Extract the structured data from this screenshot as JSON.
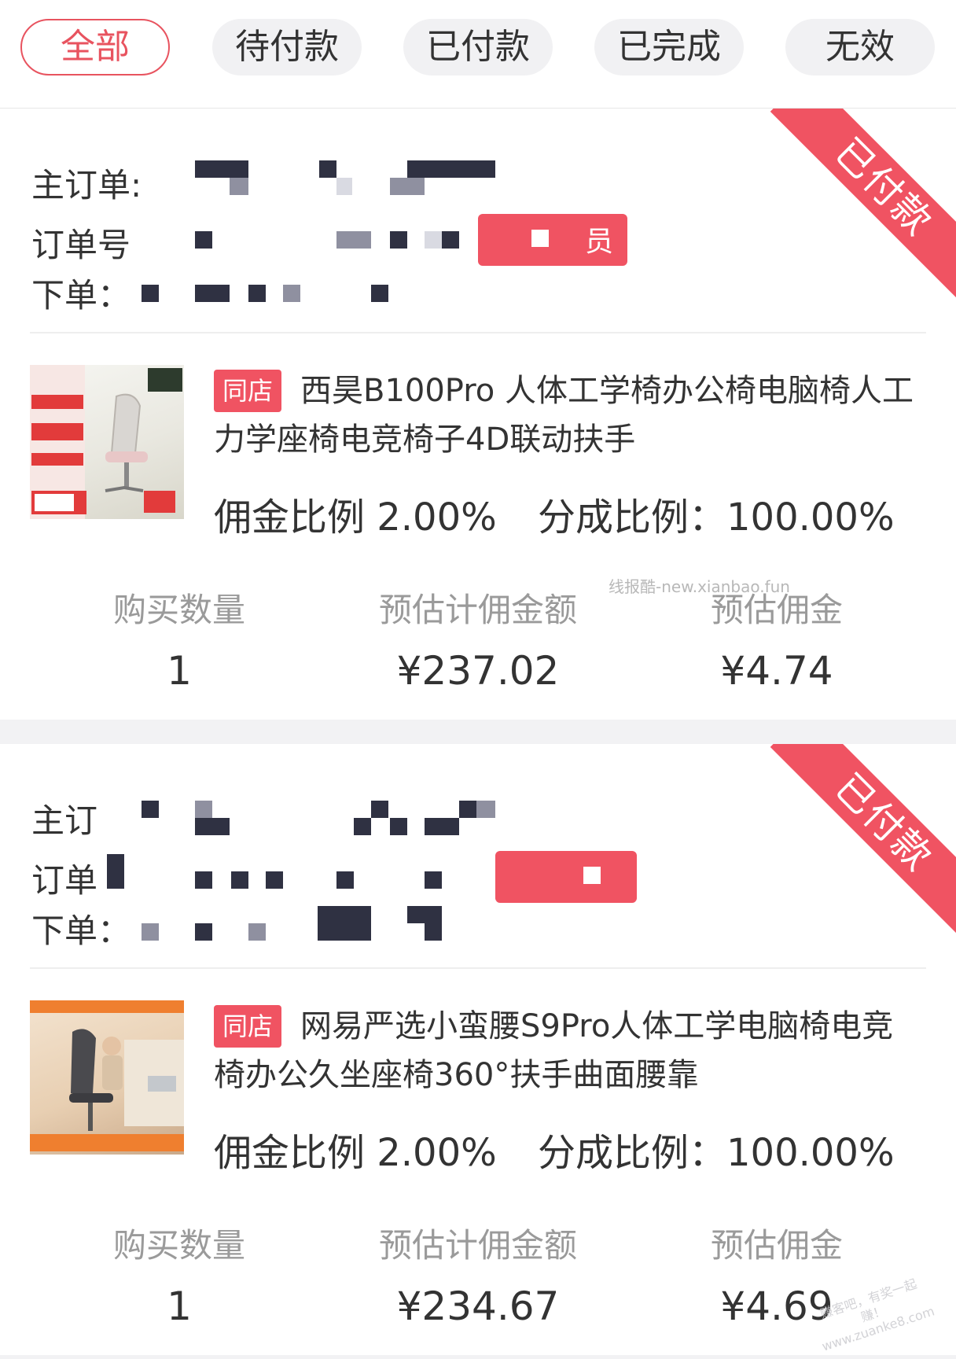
{
  "tabs": [
    {
      "label": "全部",
      "active": true
    },
    {
      "label": "待付款",
      "active": false
    },
    {
      "label": "已付款",
      "active": false
    },
    {
      "label": "已完成",
      "active": false
    },
    {
      "label": "无效",
      "active": false
    }
  ],
  "accent_color": "#f05362",
  "orders": [
    {
      "status": "已付款",
      "main_order_label": "主订单:",
      "order_no_label": "订单号",
      "placed_label": "下单：",
      "member_tag": "员",
      "shop_badge": "同店",
      "product_title": "西昊B100Pro 人体工学椅办公椅电脑椅人工力学座椅电竞椅子4D联动扶手",
      "commission_rate": "佣金比例 2.00%",
      "share_rate": "分成比例：100.00%",
      "headers": [
        "购买数量",
        "预估计佣金额",
        "预估佣金"
      ],
      "values": [
        "1",
        "¥237.02",
        "¥4.74"
      ]
    },
    {
      "status": "已付款",
      "main_order_label": "主订",
      "order_no_label": "订单",
      "placed_label": "下单：",
      "member_tag": "",
      "shop_badge": "同店",
      "product_title": "网易严选小蛮腰S9Pro人体工学电脑椅电竞椅办公久坐座椅360°扶手曲面腰靠",
      "commission_rate": "佣金比例 2.00%",
      "share_rate": "分成比例：100.00%",
      "headers": [
        "购买数量",
        "预估计佣金额",
        "预估佣金"
      ],
      "values": [
        "1",
        "¥234.67",
        "¥4.69"
      ]
    }
  ],
  "watermark": "线报酷-new.xianbao.fun",
  "corner_stamp": "赚客吧，有奖一起赚！ www.zuanke8.com"
}
